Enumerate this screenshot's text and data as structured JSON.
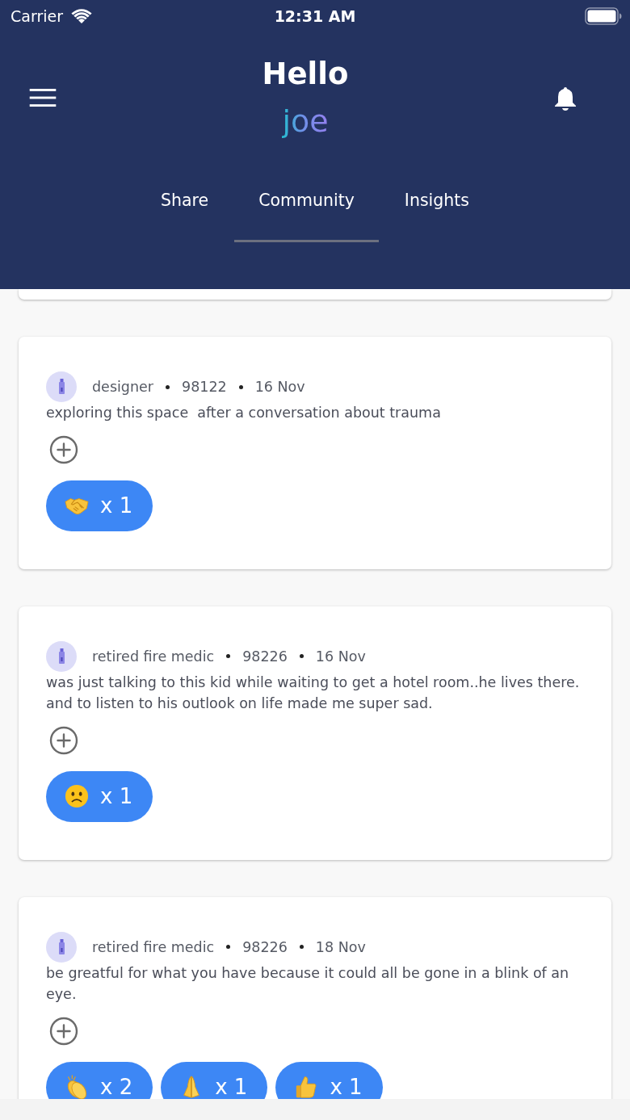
{
  "status_bar": {
    "carrier": "Carrier",
    "time": "12:31 AM"
  },
  "header": {
    "greeting": "Hello",
    "username": "joe"
  },
  "tabs": [
    {
      "label": "Share",
      "selected": false
    },
    {
      "label": "Community",
      "selected": true
    },
    {
      "label": "Insights",
      "selected": false
    }
  ],
  "posts": [
    {
      "author": "designer",
      "zip": "98122",
      "date": "16 Nov",
      "text": "exploring this space  after a conversation about trauma",
      "reactions": [
        {
          "kind": "handshake",
          "count": "x 1"
        }
      ]
    },
    {
      "author": "retired fire medic",
      "zip": "98226",
      "date": "16 Nov",
      "text": "was just talking to this kid while waiting to get a hotel room..he lives there. and to listen to his outlook on life made me super sad.",
      "reactions": [
        {
          "kind": "frown",
          "count": "x 1"
        }
      ]
    },
    {
      "author": "retired fire medic",
      "zip": "98226",
      "date": "18 Nov",
      "text": "be greatful for what you have because it could all be gone in a blink of an eye.",
      "reactions": [
        {
          "kind": "clap",
          "count": "x 2"
        },
        {
          "kind": "pray",
          "count": "x 1"
        },
        {
          "kind": "thumbs_up",
          "count": "x 1"
        }
      ]
    }
  ]
}
